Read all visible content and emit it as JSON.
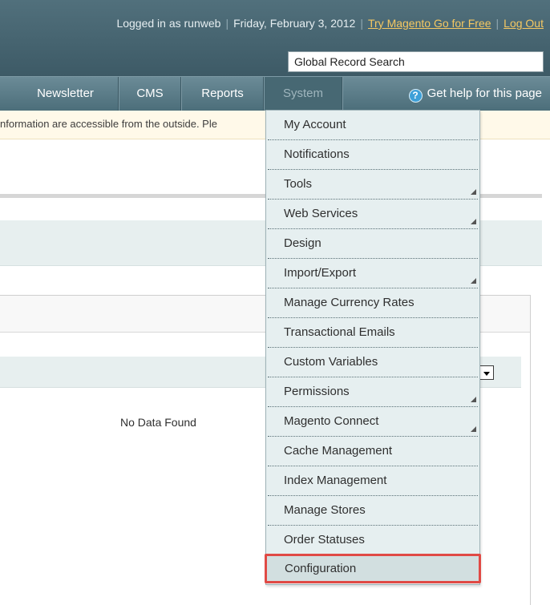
{
  "header": {
    "logged_in": "Logged in as runweb",
    "date": "Friday, February 3, 2012",
    "try_link": "Try Magento Go for Free",
    "logout_link": "Log Out",
    "search_value": "Global Record Search"
  },
  "nav": {
    "items": [
      "Newsletter",
      "CMS",
      "Reports",
      "System"
    ],
    "help": "Get help for this page",
    "help_glyph": "?"
  },
  "notice": {
    "text": "nformation are accessible from the outside. Ple"
  },
  "grid": {
    "empty_text": "No Data Found"
  },
  "system_menu": {
    "items": [
      {
        "label": "My Account"
      },
      {
        "label": "Notifications"
      },
      {
        "label": "Tools"
      },
      {
        "label": "Web Services"
      },
      {
        "label": "Design"
      },
      {
        "label": "Import/Export"
      },
      {
        "label": "Manage Currency Rates"
      },
      {
        "label": "Transactional Emails"
      },
      {
        "label": "Custom Variables"
      },
      {
        "label": "Permissions"
      },
      {
        "label": "Magento Connect"
      },
      {
        "label": "Cache Management"
      },
      {
        "label": "Index Management"
      },
      {
        "label": "Manage Stores"
      },
      {
        "label": "Order Statuses"
      },
      {
        "label": "Configuration"
      }
    ]
  },
  "colors": {
    "header": "#3d5a66",
    "accent_link": "#f5c862",
    "menu_bg": "#e6eff0",
    "highlight_border": "#e04a45"
  }
}
